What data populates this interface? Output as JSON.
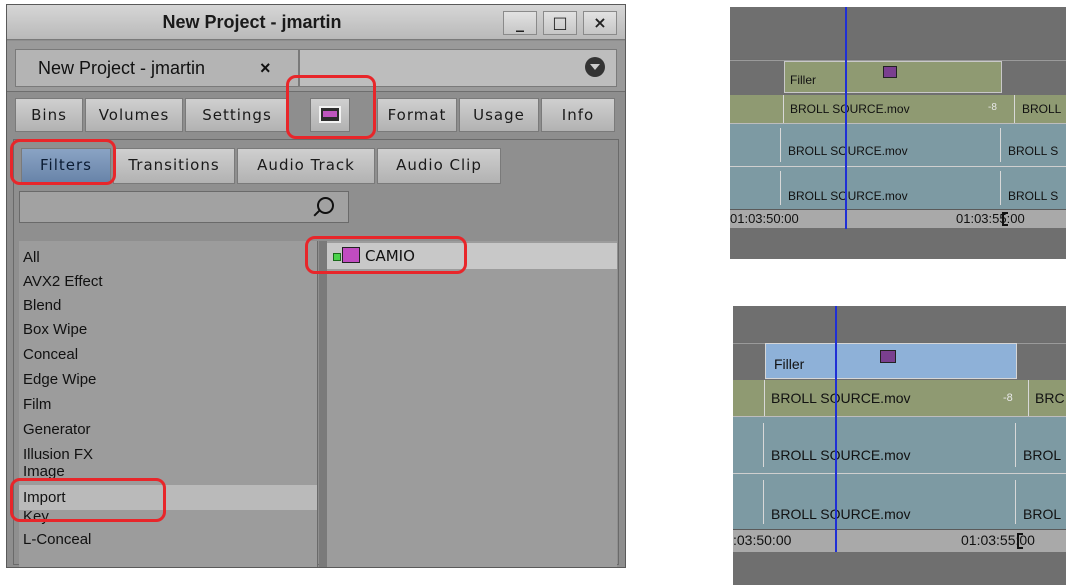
{
  "project_window": {
    "title": "New Project - jmartin",
    "window_buttons": [
      "_",
      "□",
      "×"
    ],
    "project_tab": {
      "label": "New Project - jmartin",
      "close": "×"
    },
    "toolbar_tabs": [
      "Bins",
      "Volumes",
      "Settings",
      "Format",
      "Usage",
      "Info"
    ],
    "effects_tab_icon": "effect-palette-icon",
    "effect_type_tabs": [
      "Filters",
      "Transitions",
      "Audio Track",
      "Audio Clip"
    ],
    "selected_effect_type": "Filters",
    "search": {
      "placeholder": "",
      "value": ""
    },
    "categories": [
      "All",
      "AVX2 Effect",
      "Blend",
      "Box Wipe",
      "Conceal",
      "Edge Wipe",
      "Film",
      "Generator",
      "Illusion FX",
      "Image",
      "Import",
      "Key",
      "L-Conceal"
    ],
    "selected_category": "Import",
    "effects": [
      {
        "name": "CAMIO",
        "icon": "avx-effect-icon"
      }
    ]
  },
  "timeline_before": {
    "filler_label": "Filler",
    "track_top": {
      "clip": "BROLL SOURCE.mov",
      "edge": "-8",
      "next": "BROLL"
    },
    "track_mid": {
      "clip": "BROLL SOURCE.mov",
      "next": "BROLL S"
    },
    "track_low": {
      "clip": "BROLL SOURCE.mov",
      "next": "BROLL S"
    },
    "timecode_left": "01:03:50:00",
    "timecode_right": "01:03:55:00"
  },
  "timeline_after": {
    "filler_label": "Filler",
    "track_top": {
      "clip": "BROLL SOURCE.mov",
      "edge": "-8",
      "next": "BRC"
    },
    "track_mid": {
      "clip": "BROLL SOURCE.mov",
      "next": "BROL"
    },
    "track_low": {
      "clip": "BROLL SOURCE.mov",
      "next": "BROL"
    },
    "timecode_left": ":03:50:00",
    "timecode_right": "01:03:55:00"
  },
  "colors": {
    "highlight": "#e8262a",
    "playhead": "#1f2fd6",
    "selected_filler": "#8eb1d8",
    "filler": "#8f9a72",
    "video_track": "#7d9aa3"
  }
}
